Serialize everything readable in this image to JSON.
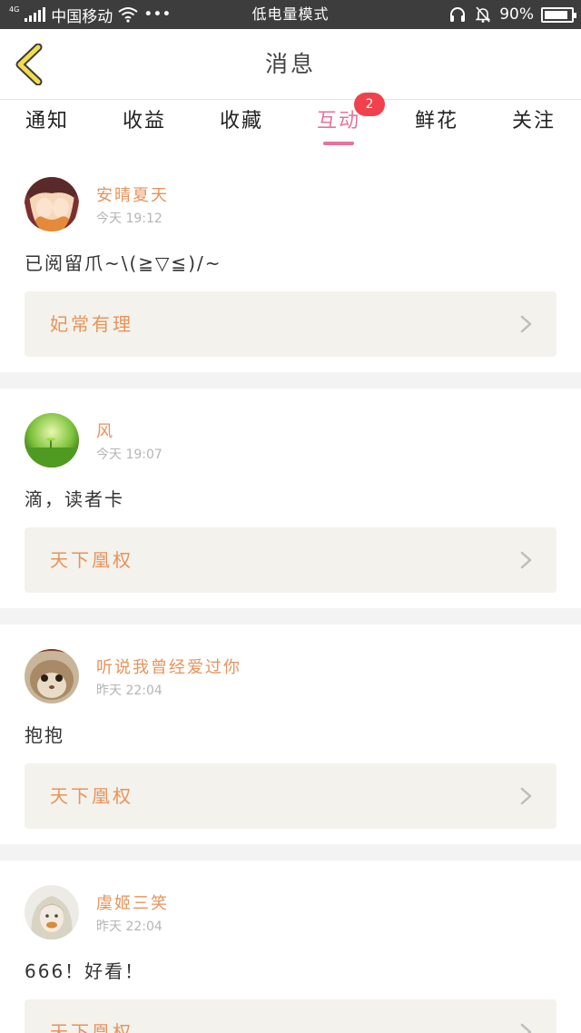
{
  "status_bar": {
    "network_type": "4G",
    "carrier": "中国移动",
    "more": "•••",
    "mode": "低电量模式",
    "battery_percent": "90%",
    "battery_level": 0.9
  },
  "header": {
    "title": "消息"
  },
  "tabs": [
    {
      "label": "通知"
    },
    {
      "label": "收益"
    },
    {
      "label": "收藏"
    },
    {
      "label": "互动",
      "badge": "2",
      "active": true
    },
    {
      "label": "鲜花"
    },
    {
      "label": "关注"
    }
  ],
  "messages": [
    {
      "user": "安晴夏天",
      "time": "今天 19:12",
      "text": "已阅留爪~\\(≧▽≦)/~",
      "book": "妃常有理"
    },
    {
      "user": "风",
      "time": "今天 19:07",
      "text": "滴，读者卡",
      "book": "天下凰权"
    },
    {
      "user": "听说我曾经爱过你",
      "time": "昨天 22:04",
      "text": "抱抱",
      "book": "天下凰权"
    },
    {
      "user": "虞姬三笑",
      "time": "昨天 22:04",
      "text": "666！好看！",
      "book": "天下凰权"
    }
  ],
  "colors": {
    "accent_pink": "#e8739a",
    "name_orange": "#e7935b",
    "badge_red": "#f0414d",
    "back_yellow": "#f2dd4a"
  }
}
